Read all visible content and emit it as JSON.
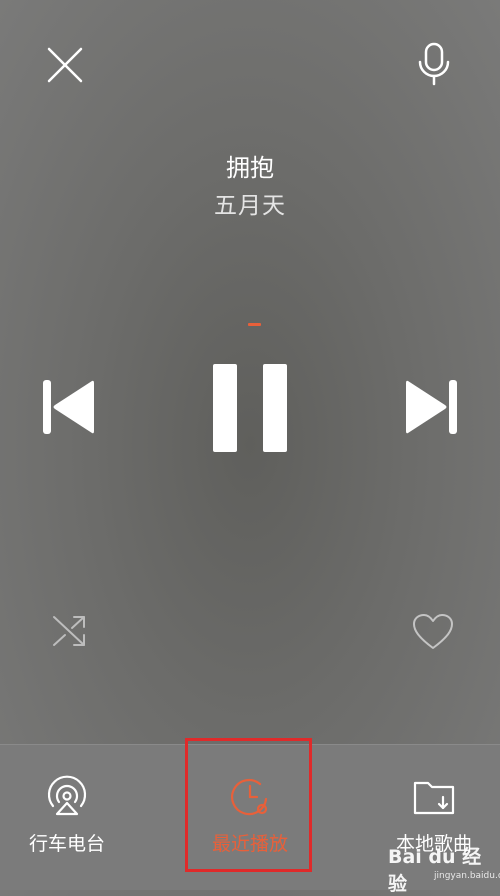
{
  "song": {
    "title": "拥抱",
    "artist": "五月天"
  },
  "player": {
    "is_playing": true
  },
  "tabs": [
    {
      "label": "行车电台",
      "icon": "car-radio-icon",
      "active": false
    },
    {
      "label": "最近播放",
      "icon": "clock-icon",
      "active": true
    },
    {
      "label": "本地歌曲",
      "icon": "folder-download-icon",
      "active": false
    }
  ],
  "colors": {
    "accent": "#e8603a",
    "highlight_box": "#e02a2a"
  },
  "watermark": {
    "brand": "Bai du 经验",
    "url": "jingyan.baidu.com"
  }
}
